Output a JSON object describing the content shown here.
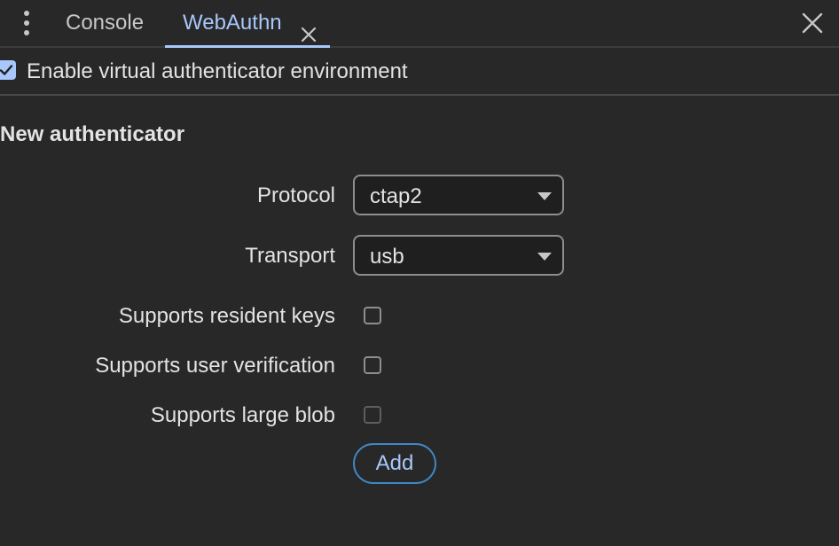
{
  "tabs": {
    "console": "Console",
    "webauthn": "WebAuthn"
  },
  "enable": {
    "label": "Enable virtual authenticator environment",
    "checked": true
  },
  "new_authenticator": {
    "title": "New authenticator",
    "protocol": {
      "label": "Protocol",
      "value": "ctap2"
    },
    "transport": {
      "label": "Transport",
      "value": "usb"
    },
    "resident_keys": {
      "label": "Supports resident keys",
      "checked": false
    },
    "user_verification": {
      "label": "Supports user verification",
      "checked": false
    },
    "large_blob": {
      "label": "Supports large blob",
      "checked": false,
      "disabled": true
    },
    "add_label": "Add"
  },
  "colors": {
    "accent": "#a8c7fa",
    "background": "#282828",
    "button_border": "#3f88c5"
  },
  "icons": [
    "more-vert-icon",
    "close-icon",
    "checkmark-icon",
    "dropdown-arrow-icon"
  ]
}
